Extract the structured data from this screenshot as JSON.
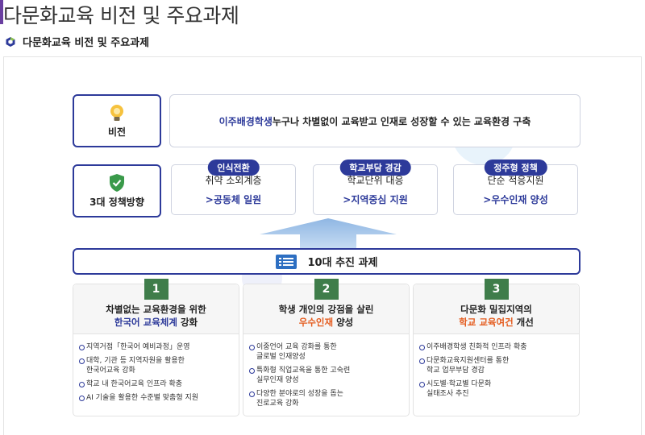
{
  "page_title": "다문화교육 비전 및 주요과제",
  "section_heading": "다문화교육 비전 및 주요과제",
  "colors": {
    "navy": "#2d3a9a",
    "orange": "#e45a1c",
    "green": "#3a7a3a"
  },
  "vision": {
    "label": "비전",
    "icon": "lightbulb-icon",
    "highlight": "이주배경학생",
    "text": " 누구나 차별없이 교육받고 인재로 성장할 수 있는 교육환경 구축"
  },
  "policy": {
    "label": "3대 정책방향",
    "icon": "shield-check-icon",
    "cards": [
      {
        "tag": "인식전환",
        "main": "취약 소외계층",
        "sub": "공동체 일원"
      },
      {
        "tag": "학교부담 경감",
        "main": "학교단위 대응",
        "sub": "지역중심 지원"
      },
      {
        "tag": "정주형 정책",
        "main": "단순 적응지원",
        "sub": "우수인재 양성"
      }
    ]
  },
  "tasks_bar": {
    "label": "10대 추진 과제",
    "icon": "document-list-icon"
  },
  "tasks": [
    {
      "num": "1",
      "title_line1": "차별없는 교육환경을 위한",
      "title_hl": "한국어 교육체계",
      "title_rest": " 강화",
      "items": [
        "지역거점「한국어 예비과정」운영",
        "대학, 기관 등 지역자원을 활용한\n한국어교육 강화",
        "학교 내 한국어교육 인프라 확충",
        "AI 기술을 활용한 수준별 맞춤형 지원"
      ]
    },
    {
      "num": "2",
      "title_line1": "학생 개인의 강점을 살린",
      "title_hl": "우수인재",
      "title_rest": " 양성",
      "items": [
        "이중언어 교육 강화를 통한\n글로벌 인재양성",
        "특화형 직업교육을 통한 고숙련\n실무인재 양성",
        "다양한 분야로의 성장을 돕는\n진로교육 강화"
      ]
    },
    {
      "num": "3",
      "title_line1": "다문화 밀집지역의",
      "title_hl": "학교 교육여건",
      "title_rest": " 개선",
      "items": [
        "이주배경학생 친화적 인프라 확충",
        "다문화교육지원센터를 통한\n학교 업무부담 경감",
        "시도별·학교별 다문화\n실태조사 추진"
      ]
    }
  ]
}
